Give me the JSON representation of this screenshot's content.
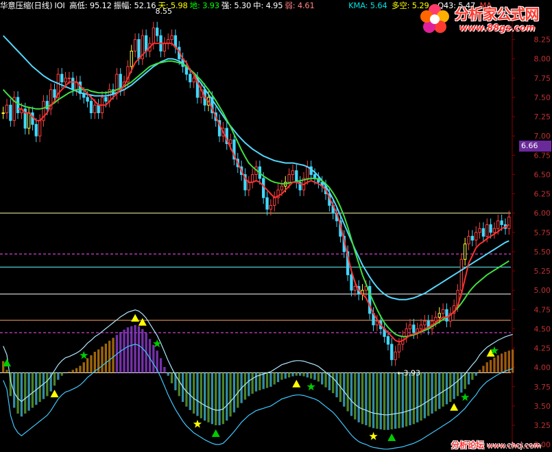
{
  "header": {
    "title": "华意压缩(日线)",
    "indicator": "IOI",
    "items": [
      {
        "label": "高低:",
        "value": "95.12",
        "color": "#ffffff"
      },
      {
        "label": "振幅:",
        "value": "52.16",
        "color": "#ffffff"
      },
      {
        "label": "天:",
        "value": "5.98",
        "color": "#ffff00"
      },
      {
        "label": "地:",
        "value": "3.93",
        "color": "#00ff00"
      },
      {
        "label": "强:",
        "value": "5.30",
        "color": "#ffffff"
      },
      {
        "label": "中:",
        "value": "4.95",
        "color": "#ffffff"
      },
      {
        "label": "弱:",
        "value": "4.61",
        "color": "#ff8080"
      }
    ],
    "kma": "KMA: 5.64",
    "duokong": "多空: 5.29",
    "q43": "Q43: 5.47",
    "ma": "MA"
  },
  "logo": {
    "title": "分析家公式网",
    "url": "www.88gs.com"
  },
  "watermark": {
    "text": "分析论坛",
    "url": "www.chcj.com"
  },
  "price_tag": "6.66",
  "chart_data": {
    "type": "candlestick",
    "ylim": [
      2.93,
      8.62
    ],
    "y_ticks": [
      "8.25",
      "8.00",
      "7.75",
      "7.50",
      "7.25",
      "7.00",
      "6.75",
      "6.50",
      "6.25",
      "6.00",
      "5.75",
      "5.50",
      "5.25",
      "5.00",
      "4.75",
      "4.50",
      "4.25",
      "4.00",
      "3.75",
      "3.50",
      "3.25",
      "3.00"
    ],
    "annotations": [
      {
        "text": "8.55",
        "value": 8.55
      },
      {
        "text": "3.93",
        "value": 3.93
      }
    ],
    "levels": [
      {
        "value": 6.0,
        "color": "#ffffaa",
        "style": "solid"
      },
      {
        "value": 5.47,
        "color": "#ff55ff",
        "style": "dashed"
      },
      {
        "value": 5.3,
        "color": "#66ffff",
        "style": "solid"
      },
      {
        "value": 4.95,
        "color": "#ffffff",
        "style": "solid"
      },
      {
        "value": 4.61,
        "color": "#ffaa66",
        "style": "solid"
      },
      {
        "value": 4.45,
        "color": "#ff55ff",
        "style": "dashed"
      },
      {
        "value": 3.93,
        "color": "#ffffff",
        "style": "solid"
      }
    ],
    "closes": [
      7.3,
      7.4,
      7.2,
      7.5,
      7.3,
      7.35,
      7.1,
      7.3,
      7.15,
      7.0,
      7.2,
      7.45,
      7.35,
      7.6,
      7.5,
      7.8,
      7.7,
      7.75,
      7.75,
      7.6,
      7.7,
      7.55,
      7.5,
      7.45,
      7.3,
      7.4,
      7.3,
      7.5,
      7.45,
      7.6,
      7.55,
      7.8,
      7.6,
      7.7,
      7.9,
      8.1,
      8.25,
      8.0,
      8.3,
      8.1,
      8.2,
      8.4,
      8.3,
      8.1,
      8.2,
      8.25,
      8.3,
      8.15,
      8.0,
      7.9,
      7.8,
      7.7,
      7.75,
      7.5,
      7.6,
      7.4,
      7.5,
      7.3,
      7.2,
      7.0,
      7.1,
      6.9,
      6.95,
      6.7,
      6.6,
      6.5,
      6.3,
      6.4,
      6.5,
      6.6,
      6.45,
      6.2,
      6.05,
      6.1,
      6.2,
      6.3,
      6.35,
      6.4,
      6.5,
      6.55,
      6.4,
      6.3,
      6.45,
      6.6,
      6.5,
      6.45,
      6.4,
      6.35,
      6.25,
      6.1,
      6.0,
      5.9,
      5.7,
      5.5,
      5.2,
      5.0,
      5.05,
      4.95,
      5.0,
      5.05,
      4.7,
      4.55,
      4.6,
      4.5,
      4.4,
      4.3,
      4.1,
      4.2,
      4.3,
      4.4,
      4.5,
      4.55,
      4.45,
      4.5,
      4.55,
      4.6,
      4.5,
      4.6,
      4.65,
      4.7,
      4.75,
      4.6,
      4.7,
      4.8,
      5.0,
      5.4,
      5.6,
      5.7,
      5.65,
      5.75,
      5.8,
      5.7,
      5.85,
      5.75,
      5.8,
      5.9,
      5.85,
      5.8,
      5.95
    ],
    "ma_fast": [
      null,
      null,
      null,
      null,
      7.35,
      7.35,
      7.3,
      7.3,
      7.25,
      7.2,
      7.2,
      7.25,
      7.3,
      7.4,
      7.45,
      7.55,
      7.6,
      7.65,
      7.7,
      7.7,
      7.7,
      7.65,
      7.6,
      7.55,
      7.5,
      7.45,
      7.4,
      7.4,
      7.4,
      7.45,
      7.5,
      7.55,
      7.6,
      7.65,
      7.75,
      7.85,
      7.95,
      8.0,
      8.05,
      8.1,
      8.15,
      8.2,
      8.2,
      8.2,
      8.2,
      8.2,
      8.2,
      8.15,
      8.1,
      8.0,
      7.95,
      7.85,
      7.8,
      7.7,
      7.6,
      7.5,
      7.45,
      7.35,
      7.25,
      7.15,
      7.05,
      6.95,
      6.85,
      6.75,
      6.65,
      6.55,
      6.45,
      6.4,
      6.4,
      6.42,
      6.4,
      6.35,
      6.3,
      6.25,
      6.2,
      6.22,
      6.25,
      6.3,
      6.35,
      6.4,
      6.4,
      6.38,
      6.37,
      6.4,
      6.42,
      6.4,
      6.38,
      6.35,
      6.3,
      6.2,
      6.1,
      6.0,
      5.85,
      5.65,
      5.45,
      5.25,
      5.1,
      5.0,
      4.95,
      4.9,
      4.8,
      4.7,
      4.62,
      4.55,
      4.5,
      4.45,
      4.4,
      4.35,
      4.33,
      4.35,
      4.38,
      4.42,
      4.43,
      4.45,
      4.47,
      4.5,
      4.52,
      4.55,
      4.58,
      4.62,
      4.65,
      4.65,
      4.68,
      4.72,
      4.8,
      4.95,
      5.15,
      5.35,
      5.45,
      5.55,
      5.6,
      5.63,
      5.67,
      5.7,
      5.73,
      5.76,
      5.8,
      5.82,
      5.85
    ],
    "ma_mid": [
      7.6,
      7.55,
      7.5,
      7.45,
      7.42,
      7.4,
      7.38,
      7.37,
      7.36,
      7.35,
      7.35,
      7.36,
      7.38,
      7.4,
      7.43,
      7.47,
      7.5,
      7.53,
      7.56,
      7.58,
      7.6,
      7.6,
      7.6,
      7.6,
      7.58,
      7.57,
      7.56,
      7.56,
      7.56,
      7.57,
      7.58,
      7.6,
      7.62,
      7.64,
      7.67,
      7.7,
      7.74,
      7.78,
      7.82,
      7.86,
      7.9,
      7.92,
      7.94,
      7.95,
      7.96,
      7.97,
      7.97,
      7.96,
      7.95,
      7.93,
      7.9,
      7.86,
      7.82,
      7.77,
      7.72,
      7.66,
      7.6,
      7.53,
      7.46,
      7.38,
      7.3,
      7.21,
      7.12,
      7.02,
      6.92,
      6.82,
      6.73,
      6.65,
      6.6,
      6.56,
      6.52,
      6.48,
      6.45,
      6.42,
      6.4,
      6.39,
      6.38,
      6.38,
      6.39,
      6.4,
      6.41,
      6.42,
      6.43,
      6.44,
      6.45,
      6.45,
      6.44,
      6.42,
      6.38,
      6.33,
      6.26,
      6.18,
      6.08,
      5.96,
      5.82,
      5.66,
      5.5,
      5.35,
      5.2,
      5.08,
      4.96,
      4.85,
      4.75,
      4.66,
      4.58,
      4.52,
      4.47,
      4.43,
      4.41,
      4.4,
      4.4,
      4.41,
      4.42,
      4.44,
      4.46,
      4.48,
      4.5,
      4.53,
      4.56,
      4.59,
      4.62,
      4.65,
      4.68,
      4.72,
      4.77,
      4.83,
      4.9,
      4.97,
      5.03,
      5.08,
      5.12,
      5.16,
      5.2,
      5.23,
      5.26,
      5.29,
      5.32,
      5.35,
      5.38
    ],
    "ma_slow": [
      8.3,
      8.25,
      8.2,
      8.15,
      8.1,
      8.05,
      8.0,
      7.95,
      7.9,
      7.86,
      7.82,
      7.78,
      7.75,
      7.72,
      7.7,
      7.68,
      7.66,
      7.64,
      7.62,
      7.6,
      7.58,
      7.56,
      7.55,
      7.54,
      7.53,
      7.52,
      7.52,
      7.52,
      7.52,
      7.53,
      7.54,
      7.56,
      7.58,
      7.6,
      7.63,
      7.66,
      7.7,
      7.74,
      7.78,
      7.82,
      7.86,
      7.9,
      7.93,
      7.96,
      7.98,
      8.0,
      8.0,
      7.99,
      7.97,
      7.94,
      7.9,
      7.85,
      7.8,
      7.74,
      7.68,
      7.61,
      7.54,
      7.47,
      7.4,
      7.33,
      7.26,
      7.19,
      7.13,
      7.07,
      7.01,
      6.96,
      6.91,
      6.87,
      6.83,
      6.8,
      6.77,
      6.74,
      6.72,
      6.7,
      6.68,
      6.67,
      6.66,
      6.65,
      6.65,
      6.65,
      6.64,
      6.63,
      6.62,
      6.6,
      6.57,
      6.53,
      6.48,
      6.42,
      6.35,
      6.27,
      6.18,
      6.08,
      5.97,
      5.86,
      5.75,
      5.64,
      5.53,
      5.43,
      5.33,
      5.25,
      5.17,
      5.1,
      5.04,
      4.99,
      4.95,
      4.92,
      4.9,
      4.89,
      4.88,
      4.88,
      4.88,
      4.89,
      4.9,
      4.92,
      4.94,
      4.96,
      4.99,
      5.02,
      5.05,
      5.08,
      5.11,
      5.14,
      5.17,
      5.2,
      5.23,
      5.26,
      5.29,
      5.32,
      5.35,
      5.38,
      5.41,
      5.44,
      5.47,
      5.5,
      5.53,
      5.56,
      5.59,
      5.62,
      5.64
    ],
    "oscillator": [
      0.2,
      0.05,
      -0.4,
      -0.6,
      -0.7,
      -0.75,
      -0.7,
      -0.65,
      -0.6,
      -0.55,
      -0.5,
      -0.45,
      -0.4,
      -0.32,
      -0.22,
      -0.12,
      -0.05,
      0.0,
      0.02,
      0.05,
      0.08,
      0.12,
      0.18,
      0.25,
      0.3,
      0.36,
      0.4,
      0.45,
      0.5,
      0.55,
      0.6,
      0.65,
      0.7,
      0.74,
      0.78,
      0.8,
      0.82,
      0.8,
      0.75,
      0.68,
      0.58,
      0.48,
      0.38,
      0.25,
      0.1,
      -0.05,
      -0.18,
      -0.3,
      -0.4,
      -0.5,
      -0.58,
      -0.64,
      -0.7,
      -0.74,
      -0.78,
      -0.82,
      -0.85,
      -0.88,
      -0.9,
      -0.9,
      -0.88,
      -0.82,
      -0.75,
      -0.68,
      -0.6,
      -0.52,
      -0.46,
      -0.4,
      -0.36,
      -0.32,
      -0.3,
      -0.28,
      -0.26,
      -0.24,
      -0.2,
      -0.16,
      -0.12,
      -0.1,
      -0.08,
      -0.06,
      -0.05,
      -0.05,
      -0.06,
      -0.08,
      -0.1,
      -0.12,
      -0.15,
      -0.2,
      -0.25,
      -0.3,
      -0.35,
      -0.42,
      -0.5,
      -0.58,
      -0.66,
      -0.74,
      -0.8,
      -0.85,
      -0.88,
      -0.9,
      -0.93,
      -0.95,
      -0.96,
      -0.97,
      -0.98,
      -0.98,
      -0.97,
      -0.96,
      -0.95,
      -0.94,
      -0.92,
      -0.9,
      -0.88,
      -0.85,
      -0.82,
      -0.78,
      -0.74,
      -0.7,
      -0.66,
      -0.62,
      -0.58,
      -0.54,
      -0.5,
      -0.45,
      -0.4,
      -0.34,
      -0.28,
      -0.2,
      -0.12,
      -0.05,
      0.05,
      0.12,
      0.18,
      0.22,
      0.26,
      0.3,
      0.33,
      0.36,
      0.38,
      0.4
    ],
    "markers": [
      {
        "i": 1,
        "type": "triangle",
        "color": "#00cc00"
      },
      {
        "i": 14,
        "type": "triangle",
        "color": "#ffff00"
      },
      {
        "i": 22,
        "type": "star",
        "color": "#00cc00"
      },
      {
        "i": 36,
        "type": "triangle",
        "color": "#ffff00"
      },
      {
        "i": 38,
        "type": "triangle",
        "color": "#ffff00"
      },
      {
        "i": 42,
        "type": "star",
        "color": "#00cc00"
      },
      {
        "i": 53,
        "type": "star",
        "color": "#ffff00"
      },
      {
        "i": 58,
        "type": "triangle",
        "color": "#00cc00"
      },
      {
        "i": 80,
        "type": "triangle",
        "color": "#ffff00"
      },
      {
        "i": 84,
        "type": "star",
        "color": "#00cc00"
      },
      {
        "i": 101,
        "type": "star",
        "color": "#ffff00"
      },
      {
        "i": 106,
        "type": "triangle",
        "color": "#00cc00"
      },
      {
        "i": 123,
        "type": "triangle",
        "color": "#ffff00"
      },
      {
        "i": 126,
        "type": "star",
        "color": "#00cc00"
      },
      {
        "i": 133,
        "type": "triangle",
        "color": "#ffff00"
      },
      {
        "i": 134,
        "type": "star",
        "color": "#00cc00"
      }
    ]
  }
}
